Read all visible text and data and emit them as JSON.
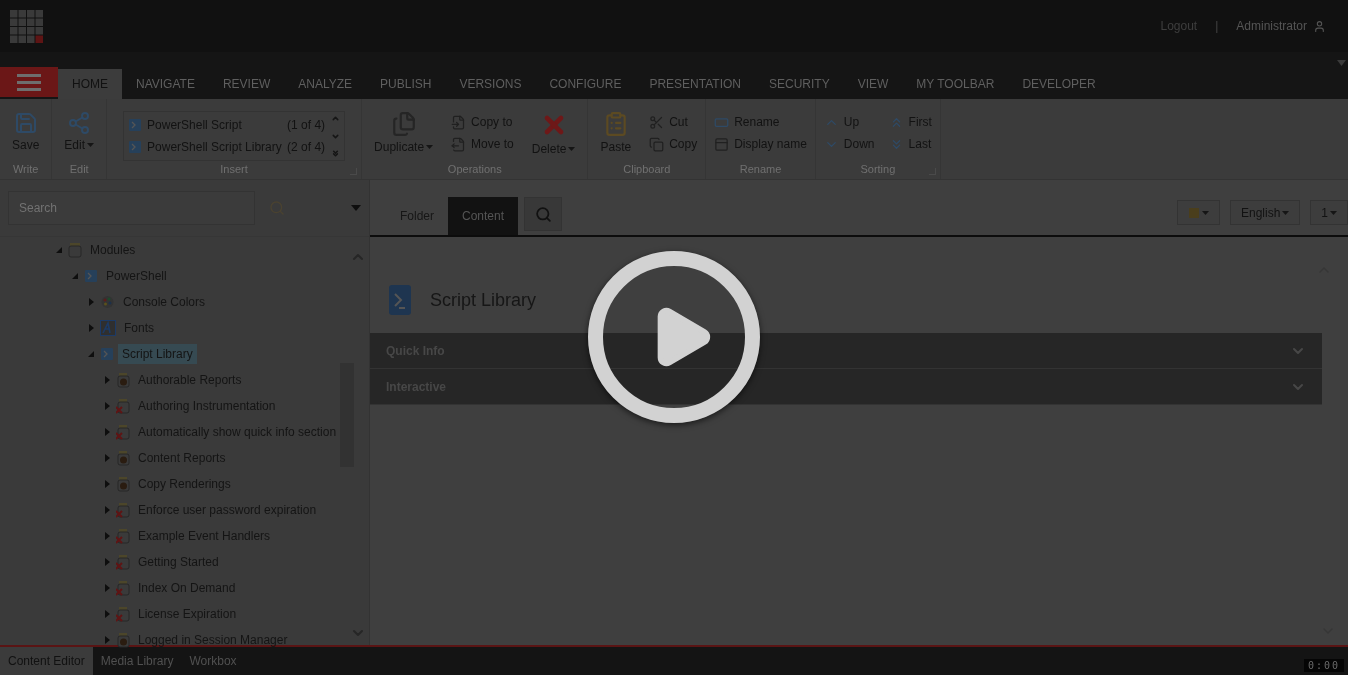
{
  "top_bar": {
    "logout": "Logout",
    "separator": "|",
    "user": "Administrator"
  },
  "menu_tabs": [
    {
      "label": "HOME",
      "selected": true
    },
    {
      "label": "NAVIGATE",
      "selected": false
    },
    {
      "label": "REVIEW",
      "selected": false
    },
    {
      "label": "ANALYZE",
      "selected": false
    },
    {
      "label": "PUBLISH",
      "selected": false
    },
    {
      "label": "VERSIONS",
      "selected": false
    },
    {
      "label": "CONFIGURE",
      "selected": false
    },
    {
      "label": "PRESENTATION",
      "selected": false
    },
    {
      "label": "SECURITY",
      "selected": false
    },
    {
      "label": "VIEW",
      "selected": false
    },
    {
      "label": "MY TOOLBAR",
      "selected": false
    },
    {
      "label": "DEVELOPER",
      "selected": false
    }
  ],
  "ribbon": [
    {
      "label": "Write",
      "launcher": false,
      "columns": [
        {
          "kind": "large",
          "label": "Save",
          "dropdown": false
        }
      ]
    },
    {
      "label": "Edit",
      "launcher": false,
      "columns": [
        {
          "kind": "large",
          "label": "Edit",
          "dropdown": true
        }
      ]
    },
    {
      "label": "Insert",
      "launcher": true,
      "columns": [
        {
          "kind": "gallery",
          "items": [
            {
              "label": "PowerShell Script",
              "count": "(1 of 4)"
            },
            {
              "label": "PowerShell Script Library",
              "count": "(2 of 4)"
            }
          ]
        }
      ]
    },
    {
      "label": "Operations",
      "launcher": false,
      "columns": [
        {
          "kind": "large",
          "label": "Duplicate",
          "dropdown": true
        },
        {
          "kind": "small",
          "items": [
            "Copy to",
            "Move to"
          ]
        },
        {
          "kind": "large",
          "label": "Delete",
          "dropdown": true
        }
      ]
    },
    {
      "label": "Clipboard",
      "launcher": false,
      "columns": [
        {
          "kind": "large",
          "label": "Paste",
          "dropdown": false
        },
        {
          "kind": "small",
          "items": [
            "Cut",
            "Copy"
          ]
        }
      ]
    },
    {
      "label": "Rename",
      "launcher": false,
      "columns": [
        {
          "kind": "small",
          "items": [
            "Rename",
            "Display name"
          ]
        }
      ]
    },
    {
      "label": "Sorting",
      "launcher": true,
      "columns": [
        {
          "kind": "small",
          "items": [
            "Up",
            "Down"
          ]
        },
        {
          "kind": "small",
          "items": [
            "First",
            "Last"
          ]
        }
      ]
    }
  ],
  "search": {
    "placeholder": "Search"
  },
  "tree": [
    {
      "label": "Modules",
      "kind": "folder",
      "expanded": true,
      "selected": false,
      "children": [
        {
          "label": "PowerShell",
          "kind": "powershell",
          "expanded": true,
          "selected": false,
          "children": [
            {
              "label": "Console Colors",
              "kind": "palette",
              "expanded": false,
              "selected": false
            },
            {
              "label": "Fonts",
              "kind": "font",
              "expanded": false,
              "selected": false
            },
            {
              "label": "Script Library",
              "kind": "library",
              "expanded": true,
              "selected": true,
              "children": [
                {
                  "label": "Authorable Reports",
                  "kind": "module",
                  "enabled": true,
                  "expanded": false,
                  "selected": false
                },
                {
                  "label": "Authoring Instrumentation",
                  "kind": "module",
                  "enabled": false,
                  "expanded": false,
                  "selected": false
                },
                {
                  "label": "Automatically show quick info section",
                  "kind": "module",
                  "enabled": false,
                  "expanded": false,
                  "selected": false
                },
                {
                  "label": "Content Reports",
                  "kind": "module",
                  "enabled": true,
                  "expanded": false,
                  "selected": false
                },
                {
                  "label": "Copy Renderings",
                  "kind": "module",
                  "enabled": true,
                  "expanded": false,
                  "selected": false
                },
                {
                  "label": "Enforce user password expiration",
                  "kind": "module",
                  "enabled": false,
                  "expanded": false,
                  "selected": false
                },
                {
                  "label": "Example Event Handlers",
                  "kind": "module",
                  "enabled": false,
                  "expanded": false,
                  "selected": false
                },
                {
                  "label": "Getting Started",
                  "kind": "module",
                  "enabled": false,
                  "expanded": false,
                  "selected": false
                },
                {
                  "label": "Index On Demand",
                  "kind": "module",
                  "enabled": false,
                  "expanded": false,
                  "selected": false
                },
                {
                  "label": "License Expiration",
                  "kind": "module",
                  "enabled": false,
                  "expanded": false,
                  "selected": false
                },
                {
                  "label": "Logged in Session Manager",
                  "kind": "module",
                  "enabled": true,
                  "expanded": false,
                  "selected": false
                }
              ]
            }
          ]
        }
      ]
    }
  ],
  "editor_tabs": [
    {
      "label": "Folder",
      "selected": false
    },
    {
      "label": "Content",
      "selected": true
    }
  ],
  "language": "English",
  "version": "1",
  "item_title": "Script Library",
  "sections": [
    {
      "label": "Quick Info",
      "expanded": false
    },
    {
      "label": "Interactive",
      "expanded": false
    }
  ],
  "bottom_tabs": [
    {
      "label": "Content Editor",
      "selected": true
    },
    {
      "label": "Media Library",
      "selected": false
    },
    {
      "label": "Workbox",
      "selected": false
    }
  ],
  "video": {
    "time": "0:00"
  }
}
